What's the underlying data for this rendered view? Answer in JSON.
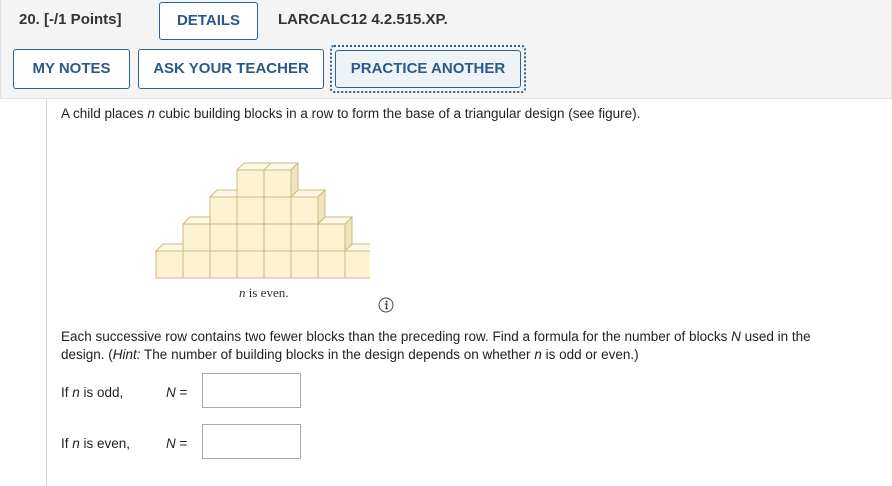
{
  "question": {
    "number_points": "20.  [-/1 Points]",
    "details_button": "DETAILS",
    "reference": "LARCALC12 4.2.515.XP.",
    "my_notes_button": "MY NOTES",
    "ask_teacher_button": "ASK YOUR TEACHER",
    "practice_button": "PRACTICE ANOTHER"
  },
  "body": {
    "intro_pre": "A child places ",
    "intro_var": "n",
    "intro_post": " cubic building blocks in a row to form the base of a triangular design (see figure).",
    "figure_caption_var": "n",
    "figure_caption_text": " is even.",
    "para_line1_pre": "Each successive row contains two fewer blocks than the preceding row. Find a formula for the number of blocks ",
    "para_line1_var": "N",
    "para_line1_post": " used in the",
    "para_line2_pre": "design. (",
    "para_line2_hint": "Hint:",
    "para_line2_mid": " The number of building blocks in the design depends on whether ",
    "para_line2_var": "n",
    "para_line2_post": " is odd or even.)"
  },
  "answers": {
    "odd_pre": "If ",
    "odd_var": "n",
    "odd_post": " is odd,",
    "even_pre": "If ",
    "even_var": "n",
    "even_post": " is even,",
    "eq_var": "N",
    "eq_sign": " =",
    "odd_value": "",
    "even_value": ""
  },
  "colors": {
    "block_fill": "#fbf3d2",
    "block_stroke": "#c9bb86",
    "button_text": "#2a5a8a"
  },
  "icons": {
    "info": "info-icon"
  }
}
